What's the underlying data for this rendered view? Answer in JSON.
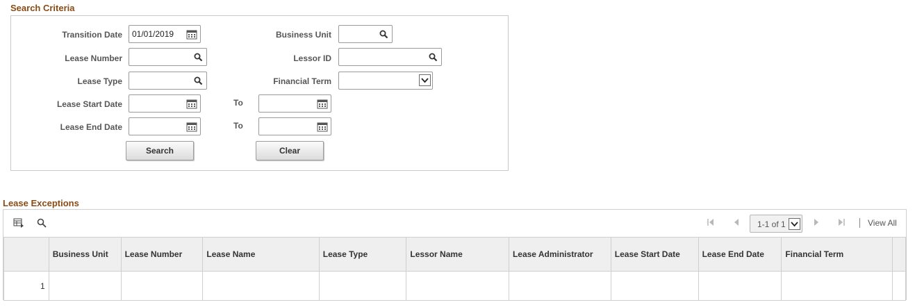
{
  "search_criteria": {
    "title": "Search Criteria",
    "transition_date": {
      "label": "Transition Date",
      "value": "01/01/2019"
    },
    "business_unit": {
      "label": "Business Unit",
      "value": ""
    },
    "lease_number": {
      "label": "Lease Number",
      "value": ""
    },
    "lessor_id": {
      "label": "Lessor ID",
      "value": ""
    },
    "lease_type": {
      "label": "Lease Type",
      "value": ""
    },
    "financial_term": {
      "label": "Financial Term",
      "value": ""
    },
    "lease_start_date": {
      "label": "Lease Start Date",
      "from": "",
      "to_label": "To",
      "to": ""
    },
    "lease_end_date": {
      "label": "Lease End Date",
      "from": "",
      "to_label": "To",
      "to": ""
    },
    "search_button": "Search",
    "clear_button": "Clear"
  },
  "lease_exceptions": {
    "title": "Lease Exceptions",
    "toolbar": {
      "personalize_icon": "grid-personalize-icon",
      "find_icon": "search-icon",
      "page_range": "1-1 of 1",
      "view_all": "View All"
    },
    "columns": [
      "",
      "Business Unit",
      "Lease Number",
      "Lease Name",
      "Lease Type",
      "Lessor Name",
      "Lease Administrator",
      "Lease Start Date",
      "Lease End Date",
      "Financial Term",
      ""
    ],
    "rows": [
      [
        "1",
        "",
        "",
        "",
        "",
        "",
        "",
        "",
        "",
        "",
        ""
      ]
    ]
  },
  "colors": {
    "section_title": "#8a4b14",
    "label": "#565656",
    "border": "#c9c9c9"
  }
}
